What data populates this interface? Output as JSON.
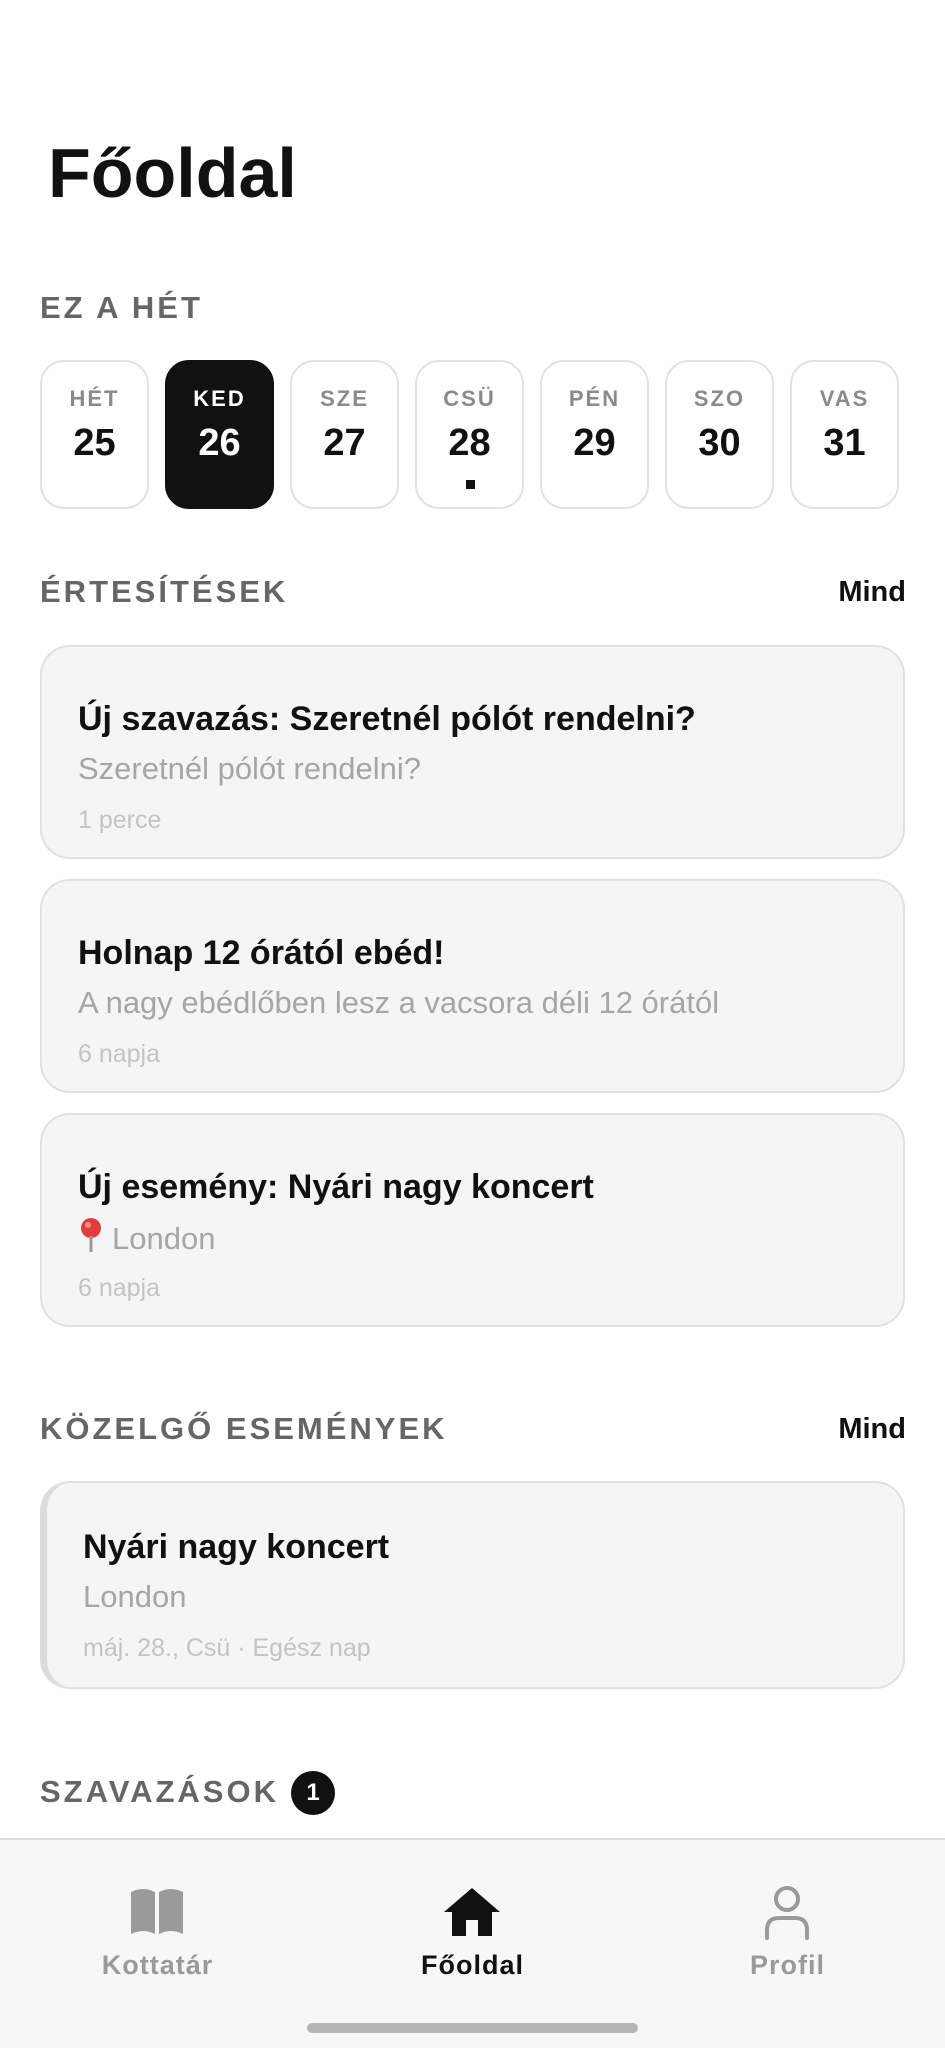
{
  "header": {
    "title": "Főoldal"
  },
  "week": {
    "section_title": "EZ A HÉT",
    "days": [
      {
        "name": "HÉT",
        "number": "25",
        "active": false,
        "has_event": false
      },
      {
        "name": "KED",
        "number": "26",
        "active": true,
        "has_event": false
      },
      {
        "name": "SZE",
        "number": "27",
        "active": false,
        "has_event": false
      },
      {
        "name": "CSÜ",
        "number": "28",
        "active": false,
        "has_event": true
      },
      {
        "name": "PÉN",
        "number": "29",
        "active": false,
        "has_event": false
      },
      {
        "name": "SZO",
        "number": "30",
        "active": false,
        "has_event": false
      },
      {
        "name": "VAS",
        "number": "31",
        "active": false,
        "has_event": false
      }
    ]
  },
  "notifications": {
    "section_title": "ÉRTESÍTÉSEK",
    "all_label": "Mind",
    "items": [
      {
        "title": "Új szavazás: Szeretnél pólót rendelni?",
        "body": "Szeretnél pólót rendelni?",
        "time": "1 perce",
        "icon": ""
      },
      {
        "title": "Holnap 12 órától ebéd!",
        "body": "A nagy ebédlőben lesz a vacsora déli 12 órától",
        "time": "6 napja",
        "icon": ""
      },
      {
        "title": "Új esemény: Nyári nagy koncert",
        "body": "London",
        "time": "6 napja",
        "icon": "pin-icon"
      }
    ]
  },
  "upcoming": {
    "section_title": "KÖZELGŐ ESEMÉNYEK",
    "all_label": "Mind",
    "event": {
      "title": "Nyári nagy koncert",
      "location": "London",
      "when": "máj. 28., Csü · Egész nap"
    }
  },
  "polls": {
    "section_title": "SZAVAZÁSOK",
    "badge_count": "1"
  },
  "tabs": [
    {
      "label": "Kottatár",
      "icon": "book-icon",
      "active": false
    },
    {
      "label": "Főoldal",
      "icon": "home-icon",
      "active": true
    },
    {
      "label": "Profil",
      "icon": "user-icon",
      "active": false
    }
  ],
  "colors": {
    "accent": "#111111",
    "muted": "#666666",
    "card_bg": "#f5f5f5"
  }
}
